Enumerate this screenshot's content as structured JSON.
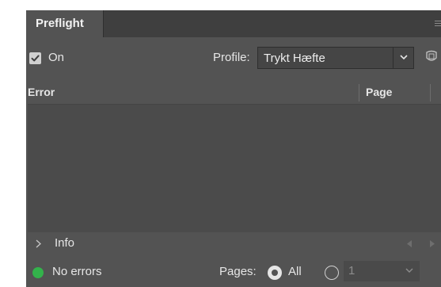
{
  "panel": {
    "tab_title": "Preflight"
  },
  "toolbar": {
    "on_checked": true,
    "on_label": "On",
    "profile_label": "Profile:",
    "profile_value": "Trykt Hæfte"
  },
  "columns": {
    "error": "Error",
    "page": "Page"
  },
  "errors": [],
  "info": {
    "label": "Info"
  },
  "status": {
    "text": "No errors",
    "color": "#33b24b",
    "pages_label": "Pages:",
    "all_label": "All",
    "all_selected": true,
    "range_value": "1"
  },
  "icons": {
    "menu": "panel-menu-icon",
    "check": "checkmark-icon",
    "dropdown": "chevron-down-icon",
    "define_profiles": "define-profiles-icon",
    "expand": "chevron-right-icon",
    "prev": "triangle-left-icon",
    "next": "triangle-right-icon"
  }
}
